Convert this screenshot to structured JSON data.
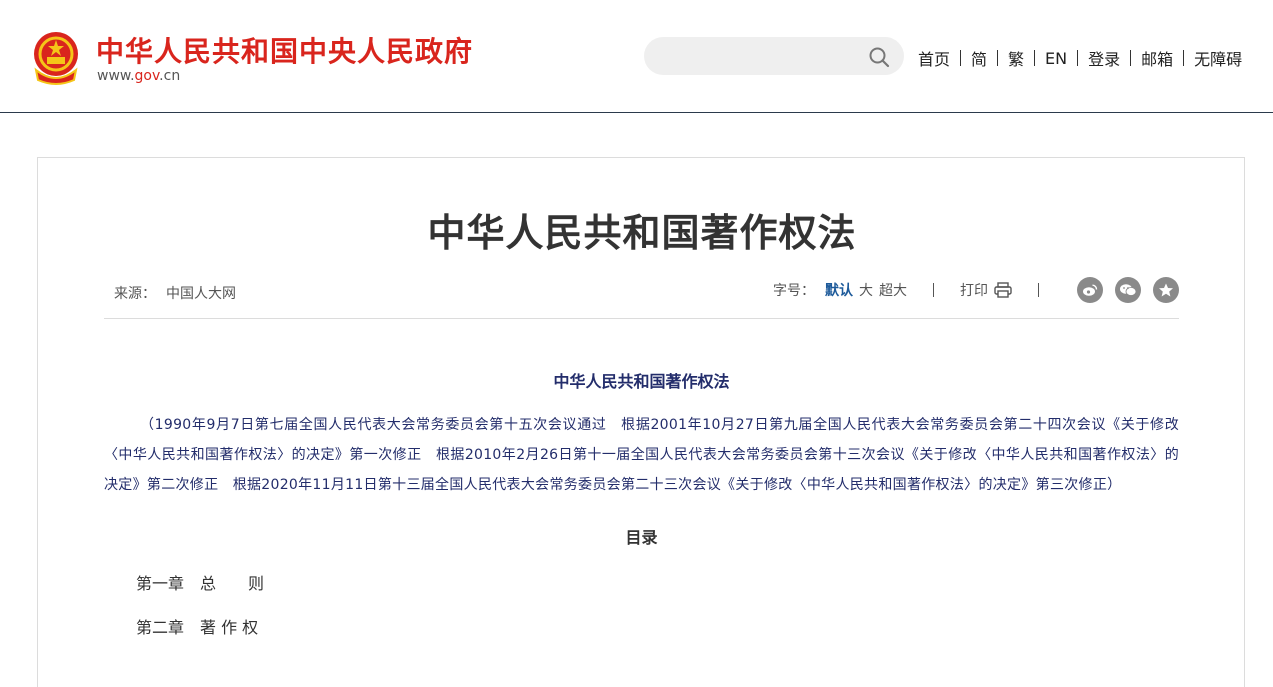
{
  "header": {
    "site_name": "中华人民共和国中央人民政府",
    "site_url_prefix": "www.",
    "site_url_gov": "gov",
    "site_url_suffix": ".cn",
    "search": {
      "placeholder": "",
      "icon": "search-icon"
    },
    "nav": [
      {
        "label": "首页"
      },
      {
        "label": "简"
      },
      {
        "label": "繁"
      },
      {
        "label": "EN"
      },
      {
        "label": "登录"
      },
      {
        "label": "邮箱"
      },
      {
        "label": "无障碍"
      }
    ]
  },
  "article": {
    "title": "中华人民共和国著作权法",
    "source_label": "来源：",
    "source_value": "中国人大网",
    "font_size_label": "字号：",
    "font_size_options": {
      "default": "默认",
      "large": "大",
      "xlarge": "超大"
    },
    "print_label": "打印",
    "share_icons": [
      "weibo-icon",
      "wechat-icon",
      "favorite-icon"
    ],
    "law_title": "中华人民共和国著作权法",
    "preamble": "（1990年9月7日第七届全国人民代表大会常务委员会第十五次会议通过　根据2001年10月27日第九届全国人民代表大会常务委员会第二十四次会议《关于修改〈中华人民共和国著作权法〉的决定》第一次修正　根据2010年2月26日第十一届全国人民代表大会常务委员会第十三次会议《关于修改〈中华人民共和国著作权法〉的决定》第二次修正　根据2020年11月11日第十三届全国人民代表大会常务委员会第二十三次会议《关于修改〈中华人民共和国著作权法〉的决定》第三次修正）",
    "toc_title": "目录",
    "toc": [
      "第一章　总　　则",
      "第二章　著 作 权"
    ]
  },
  "colors": {
    "brand_red": "#d9251d",
    "link_blue": "#1d5a9a",
    "text_navy": "#232d6b"
  }
}
